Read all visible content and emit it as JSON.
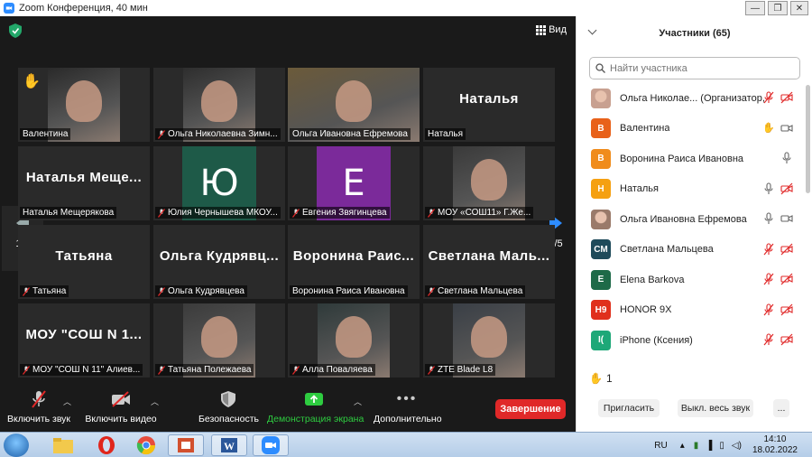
{
  "window": {
    "title": "Zoom Конференция, 40 мин",
    "minimize": "—",
    "maximize": "❐",
    "close": "✕"
  },
  "meeting": {
    "view_label": "Вид",
    "page_left": "1/5",
    "page_right": "1/5",
    "tiles": [
      {
        "name": "Валентина",
        "type": "video",
        "hand": true,
        "muted": false,
        "bg": "#2a2a2a"
      },
      {
        "name": "Ольга Николаевна Зимн...",
        "type": "video",
        "muted": true,
        "bg": "#2e2e2e"
      },
      {
        "name": "Ольга Ивановна  Ефремова",
        "type": "video",
        "muted": false,
        "active": true,
        "bg": "#6b5a3a"
      },
      {
        "name": "Наталья",
        "type": "name",
        "big": "Наталья",
        "muted": false
      },
      {
        "name": "Наталья Мещерякова",
        "type": "name",
        "big": "Наталья  Меще...",
        "muted": false
      },
      {
        "name": "Юлия Чернышева МКОУ...",
        "type": "initial",
        "initial": "Ю",
        "color": "#1e5a48",
        "muted": true
      },
      {
        "name": "Евгения Звягинцева",
        "type": "initial",
        "initial": "Е",
        "color": "#7b2a9a",
        "muted": true
      },
      {
        "name": "МОУ «СОШ11» Г.Же...",
        "type": "video",
        "muted": true,
        "bg": "#3a3a3a"
      },
      {
        "name": "Татьяна",
        "type": "name",
        "big": "Татьяна",
        "muted": true
      },
      {
        "name": "Ольга Кудрявцева",
        "type": "name",
        "big": "Ольга  Кудрявц...",
        "muted": true
      },
      {
        "name": "Воронина Раиса Ивановна",
        "type": "name",
        "big": "Воронина  Раис...",
        "muted": false
      },
      {
        "name": "Светлана Мальцева",
        "type": "name",
        "big": "Светлана  Маль...",
        "muted": true
      },
      {
        "name": "МОУ \"СОШ N 11\" Алиев...",
        "type": "name",
        "big": "МОУ  \"СОШ  N  1...",
        "muted": true
      },
      {
        "name": "Татьяна Полежаева",
        "type": "video",
        "muted": true,
        "bg": "#3b3b3b"
      },
      {
        "name": "Алла Поваляева",
        "type": "video",
        "muted": true,
        "bg": "#2f3a3a"
      },
      {
        "name": "ZTE Blade L8",
        "type": "video",
        "muted": true,
        "bg": "#3a3f46"
      }
    ]
  },
  "toolbar": {
    "unmute": "Включить звук",
    "start_video": "Включить видео",
    "security": "Безопасность",
    "share_screen": "Демонстрация экрана",
    "more": "Дополнительно",
    "end": "Завершение"
  },
  "participants": {
    "title": "Участники (65)",
    "search_placeholder": "Найти участника",
    "list": [
      {
        "name": "Ольга Николае... (Организатор, я)",
        "avatar": "",
        "color": "#c8a090",
        "photo": true,
        "mic": "muted",
        "cam": "off"
      },
      {
        "name": "Валентина",
        "avatar": "В",
        "color": "#e8611a",
        "hand": true,
        "mic": "none",
        "cam": "on"
      },
      {
        "name": "Воронина Раиса Ивановна",
        "avatar": "В",
        "color": "#f08c1c",
        "mic": "on",
        "cam": "none"
      },
      {
        "name": "Наталья",
        "avatar": "Н",
        "color": "#f5a011",
        "mic": "on",
        "cam": "off"
      },
      {
        "name": "Ольга Ивановна  Ефремова",
        "avatar": "",
        "color": "#9a7a6a",
        "photo": true,
        "mic": "on",
        "cam": "on"
      },
      {
        "name": "Светлана Мальцева",
        "avatar": "СМ",
        "color": "#1e4a5a",
        "mic": "muted",
        "cam": "off"
      },
      {
        "name": "Elena Barkova",
        "avatar": "E",
        "color": "#1e6a48",
        "mic": "muted",
        "cam": "off"
      },
      {
        "name": "HONOR 9X",
        "avatar": "H9",
        "color": "#e0301c",
        "mic": "muted",
        "cam": "off"
      },
      {
        "name": "iPhone (Ксения)",
        "avatar": "I(",
        "color": "#1ea878",
        "mic": "muted",
        "cam": "off"
      }
    ],
    "raised_hands": "1",
    "invite": "Пригласить",
    "mute_all": "Выкл. весь звук",
    "more": "..."
  },
  "taskbar": {
    "lang": "RU",
    "time": "14:10",
    "date": "18.02.2022"
  }
}
